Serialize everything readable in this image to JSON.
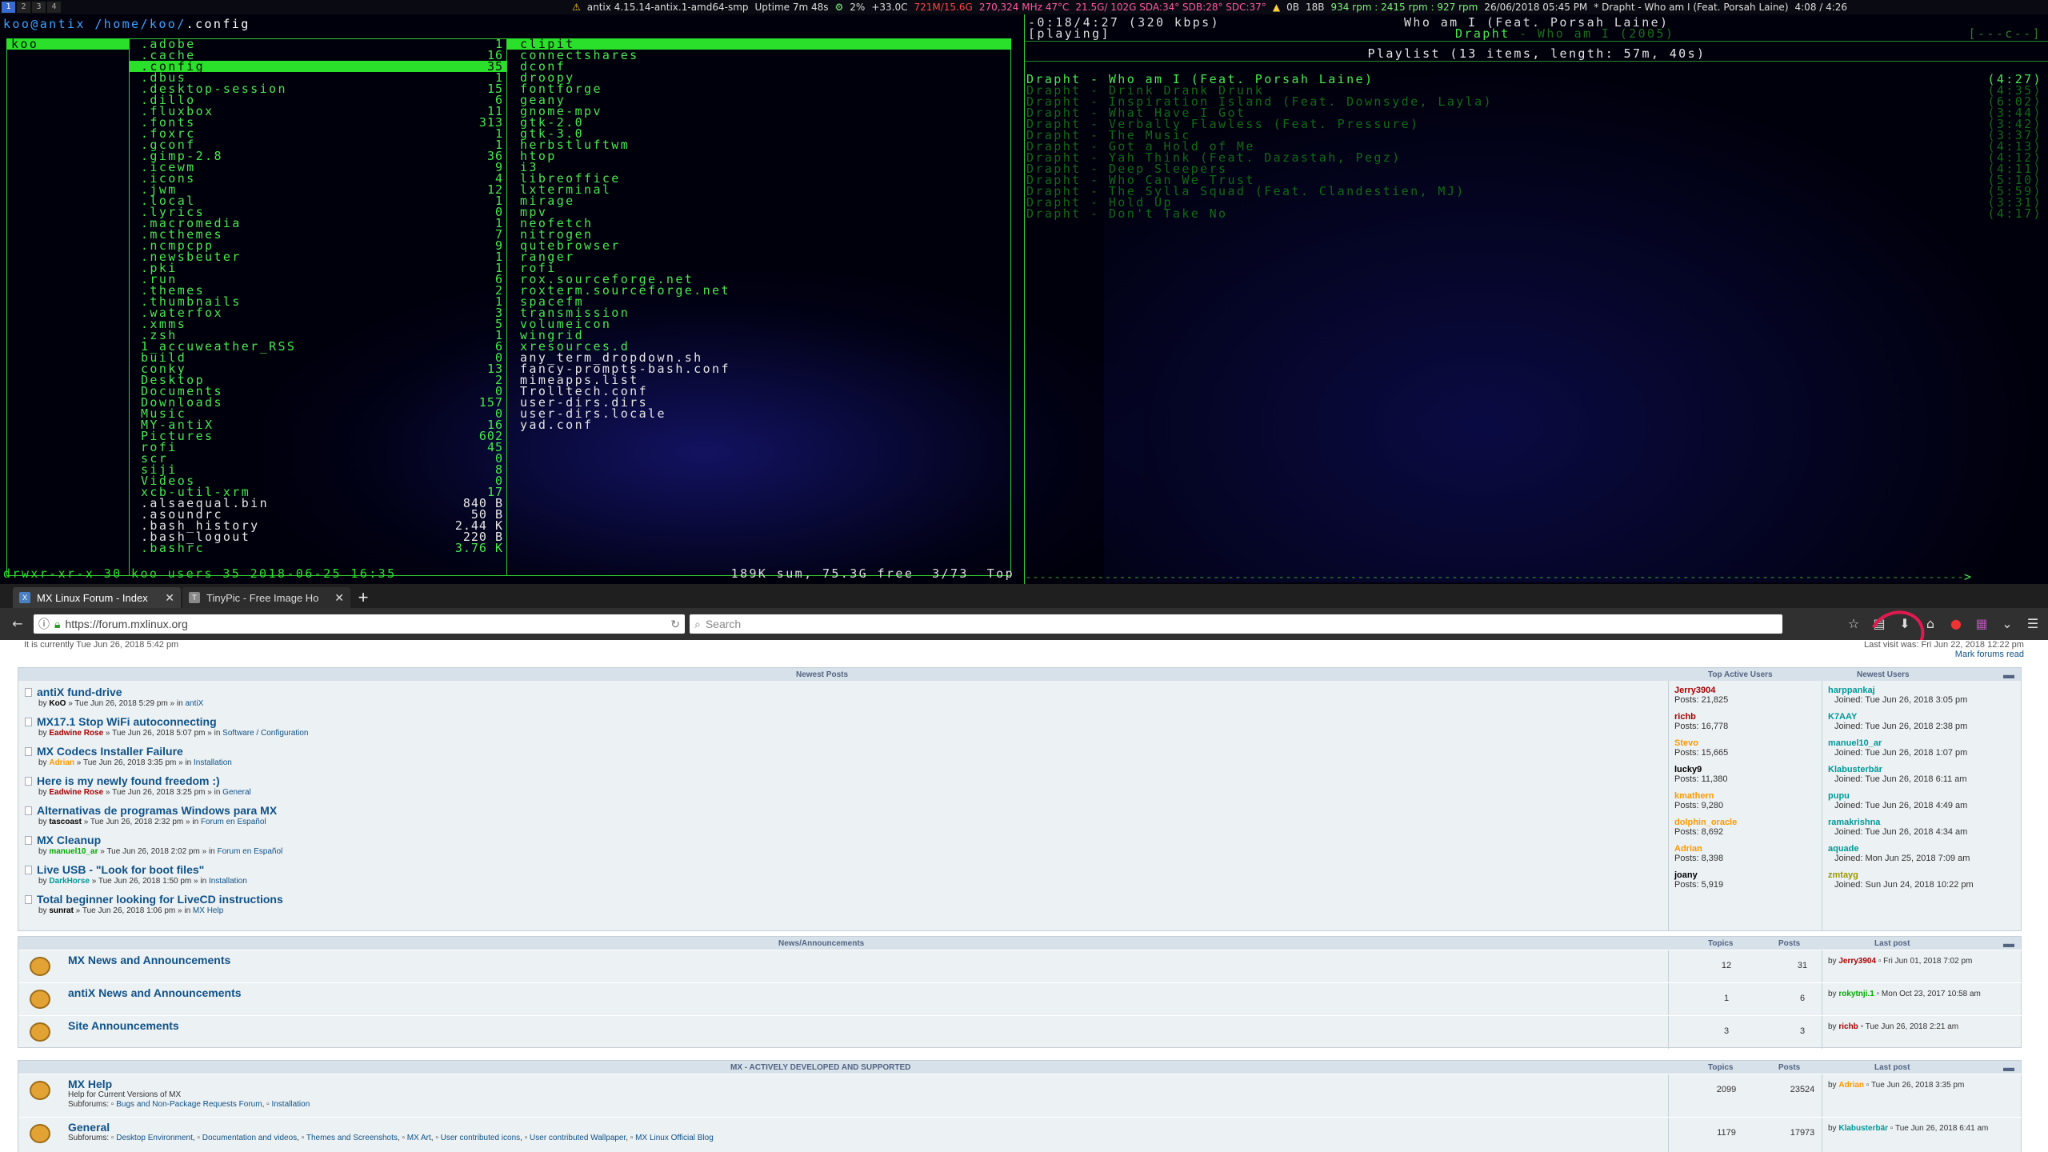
{
  "topbar": {
    "workspaces": [
      "1",
      "2",
      "3",
      "4"
    ],
    "system": "antix 4.15.14-antix.1-amd64-smp",
    "uptime": "Uptime 7m 48s",
    "cpu": "2%",
    "temp": "+33.0C",
    "mem": "721M/15.6G",
    "freq": "270,324 MHz 47°C",
    "disk": "21.5G/ 102G SDA:34° SDB:28° SDC:37°",
    "net": "0B",
    "net2": "18B",
    "fan": "934 rpm : 2415 rpm : 927 rpm",
    "date": "26/06/2018 05:45 PM",
    "nowplaying": "* Drapht - Who am I (Feat. Porsah Laine)",
    "time": "4:08 / 4:26"
  },
  "ranger": {
    "user": "koo@antix",
    "path": "/home/koo/",
    "current": ".config",
    "parent": [
      {
        "name": "koo",
        "selected": true
      }
    ],
    "middle": [
      {
        "name": ".adobe",
        "size": "1"
      },
      {
        "name": ".cache",
        "size": "16"
      },
      {
        "name": ".config",
        "size": "35",
        "selected": true
      },
      {
        "name": ".dbus",
        "size": "1"
      },
      {
        "name": ".desktop-session",
        "size": "15"
      },
      {
        "name": ".dillo",
        "size": "6"
      },
      {
        "name": ".fluxbox",
        "size": "11"
      },
      {
        "name": ".fonts",
        "size": "313"
      },
      {
        "name": ".foxrc",
        "size": "1"
      },
      {
        "name": ".gconf",
        "size": "1"
      },
      {
        "name": ".gimp-2.8",
        "size": "36"
      },
      {
        "name": ".icewm",
        "size": "9"
      },
      {
        "name": ".icons",
        "size": "4"
      },
      {
        "name": ".jwm",
        "size": "12"
      },
      {
        "name": ".local",
        "size": "1"
      },
      {
        "name": ".lyrics",
        "size": "0"
      },
      {
        "name": ".macromedia",
        "size": "1"
      },
      {
        "name": ".mcthemes",
        "size": "7"
      },
      {
        "name": ".ncmpcpp",
        "size": "9"
      },
      {
        "name": ".newsbeuter",
        "size": "1"
      },
      {
        "name": ".pki",
        "size": "1"
      },
      {
        "name": ".run",
        "size": "6"
      },
      {
        "name": ".themes",
        "size": "2"
      },
      {
        "name": ".thumbnails",
        "size": "1"
      },
      {
        "name": ".waterfox",
        "size": "3"
      },
      {
        "name": ".xmms",
        "size": "5"
      },
      {
        "name": ".zsh",
        "size": "1"
      },
      {
        "name": "1_accuweather_RSS",
        "size": "6"
      },
      {
        "name": "build",
        "size": "0"
      },
      {
        "name": "conky",
        "size": "13"
      },
      {
        "name": "Desktop",
        "size": "2"
      },
      {
        "name": "Documents",
        "size": "0"
      },
      {
        "name": "Downloads",
        "size": "157"
      },
      {
        "name": "Music",
        "size": "0"
      },
      {
        "name": "MY-antiX",
        "size": "16"
      },
      {
        "name": "Pictures",
        "size": "602"
      },
      {
        "name": "rofi",
        "size": "45"
      },
      {
        "name": "scr",
        "size": "0"
      },
      {
        "name": "siji",
        "size": "8"
      },
      {
        "name": "Videos",
        "size": "0"
      },
      {
        "name": "xcb-util-xrm",
        "size": "17"
      },
      {
        "name": ".alsaequal.bin",
        "size": "840 B",
        "file": true
      },
      {
        "name": ".asoundrc",
        "size": "50 B",
        "file": true
      },
      {
        "name": ".bash_history",
        "size": "2.44 K",
        "file": true
      },
      {
        "name": ".bash_logout",
        "size": "220 B",
        "file": true
      },
      {
        "name": ".bashrc",
        "size": "3.76 K"
      }
    ],
    "right": [
      {
        "name": "clipit",
        "selected": true
      },
      {
        "name": "connectshares"
      },
      {
        "name": "dconf"
      },
      {
        "name": "droopy"
      },
      {
        "name": "fontforge"
      },
      {
        "name": "geany"
      },
      {
        "name": "gnome-mpv"
      },
      {
        "name": "gtk-2.0"
      },
      {
        "name": "gtk-3.0"
      },
      {
        "name": "herbstluftwm"
      },
      {
        "name": "htop"
      },
      {
        "name": "i3"
      },
      {
        "name": "libreoffice"
      },
      {
        "name": "lxterminal"
      },
      {
        "name": "mirage"
      },
      {
        "name": "mpv"
      },
      {
        "name": "neofetch"
      },
      {
        "name": "nitrogen"
      },
      {
        "name": "qutebrowser"
      },
      {
        "name": "ranger"
      },
      {
        "name": "rofi"
      },
      {
        "name": "rox.sourceforge.net"
      },
      {
        "name": "roxterm.sourceforge.net"
      },
      {
        "name": "spacefm"
      },
      {
        "name": "transmission"
      },
      {
        "name": "volumeicon"
      },
      {
        "name": "wingrid"
      },
      {
        "name": "xresources.d"
      },
      {
        "name": "any_term_dropdown.sh",
        "file": true
      },
      {
        "name": "fancy-prompts-bash.conf",
        "file": true
      },
      {
        "name": "mimeapps.list",
        "file": true
      },
      {
        "name": "Trolltech.conf",
        "file": true
      },
      {
        "name": "user-dirs.dirs",
        "file": true
      },
      {
        "name": "user-dirs.locale",
        "file": true
      },
      {
        "name": "yad.conf",
        "file": true
      }
    ],
    "status_left": "drwxr-xr-x 30 koo users 35 2018-06-25 16:35",
    "status_right": "189K sum, 75.3G free  3/73  Top"
  },
  "player": {
    "time": "-0:18/4:27 (320 kbps)",
    "state": "[playing]",
    "title": "Who am I (Feat. Porsah Laine)",
    "artist": "Drapht",
    "album": " - Who am I (2005)",
    "corner": "[---c--]",
    "playlist_header": "Playlist (13 items, length: 57m, 40s)",
    "playlist": [
      {
        "track": "Drapht - Who am I (Feat. Porsah Laine)",
        "len": "(4:27)",
        "current": true
      },
      {
        "track": "Drapht - Drink Drank Drunk",
        "len": "(4:35)"
      },
      {
        "track": "Drapht - Inspiration Island (Feat. Downsyde, Layla)",
        "len": "(6:02)"
      },
      {
        "track": "Drapht - What Have I Got",
        "len": "(3:44)"
      },
      {
        "track": "Drapht - Verbally Flawless (Feat. Pressure)",
        "len": "(3:42)"
      },
      {
        "track": "Drapht - The Music",
        "len": "(3:37)"
      },
      {
        "track": "Drapht - Got a Hold of Me",
        "len": "(4:13)"
      },
      {
        "track": "Drapht - Yah Think (Feat. Dazastah, Pegz)",
        "len": "(4:12)"
      },
      {
        "track": "Drapht - Deep Sleepers",
        "len": "(4:11)"
      },
      {
        "track": "Drapht - Who Can We Trust",
        "len": "(5:10)"
      },
      {
        "track": "Drapht - The Sylla Squad (Feat. Clandestien, MJ)",
        "len": "(5:59)"
      },
      {
        "track": "Drapht - Hold Up",
        "len": "(3:31)"
      },
      {
        "track": "Drapht - Don't Take No",
        "len": "(4:17)"
      }
    ],
    "progress": 0.93
  },
  "browser": {
    "tabs": [
      {
        "label": "MX Linux Forum - Index",
        "fav": "X",
        "active": true
      },
      {
        "label": "TinyPic - Free Image Ho",
        "fav": "T",
        "active": false
      }
    ],
    "url": "https://forum.mxlinux.org",
    "search_placeholder": "Search"
  },
  "forum": {
    "last_visit": "It is currently Tue Jun 26, 2018 5:42 pm",
    "last_right": "Last visit was: Fri Jun 22, 2018 12:22 pm",
    "mark_read": "Mark forums read",
    "newest_posts_header": "Newest Posts",
    "top_active_header": "Top Active Users",
    "newest_users_header": "Newest Users",
    "posts": [
      {
        "title": "antiX fund-drive",
        "author": "KoO",
        "author_color": "#000000",
        "date": "Tue Jun 26, 2018 5:29 pm",
        "forum": "antiX"
      },
      {
        "title": "MX17.1 Stop WiFi autoconnecting",
        "author": "Eadwine Rose",
        "author_color": "#aa0000",
        "date": "Tue Jun 26, 2018 5:07 pm",
        "forum": "Software / Configuration"
      },
      {
        "title": "MX Codecs Installer Failure",
        "author": "Adrian",
        "author_color": "#ff9900",
        "date": "Tue Jun 26, 2018 3:35 pm",
        "forum": "Installation"
      },
      {
        "title": "Here is my newly found freedom :)",
        "author": "Eadwine Rose",
        "author_color": "#aa0000",
        "date": "Tue Jun 26, 2018 3:25 pm",
        "forum": "General"
      },
      {
        "title": "Alternativas de programas Windows para MX",
        "author": "tascoast",
        "author_color": "#000000",
        "date": "Tue Jun 26, 2018 2:32 pm",
        "forum": "Forum en Español"
      },
      {
        "title": "MX Cleanup",
        "author": "manuel10_ar",
        "author_color": "#00aa00",
        "date": "Tue Jun 26, 2018 2:02 pm",
        "forum": "Forum en Español"
      },
      {
        "title": "Live USB - \"Look for boot files\"",
        "author": "DarkHorse",
        "author_color": "#009999",
        "date": "Tue Jun 26, 2018 1:50 pm",
        "forum": "Installation"
      },
      {
        "title": "Total beginner looking for LiveCD instructions",
        "author": "sunrat",
        "author_color": "#000000",
        "date": "Tue Jun 26, 2018 1:06 pm",
        "forum": "MX Help"
      }
    ],
    "top_users": [
      {
        "name": "Jerry3904",
        "color": "#aa0000",
        "posts": "Posts: 21,825"
      },
      {
        "name": "richb",
        "color": "#aa0000",
        "posts": "Posts: 16,778"
      },
      {
        "name": "Stevo",
        "color": "#ff9900",
        "posts": "Posts: 15,665"
      },
      {
        "name": "lucky9",
        "color": "#000000",
        "posts": "Posts: 11,380"
      },
      {
        "name": "kmathern",
        "color": "#ff9900",
        "posts": "Posts: 9,280"
      },
      {
        "name": "dolphin_oracle",
        "color": "#ff9900",
        "posts": "Posts: 8,692"
      },
      {
        "name": "Adrian",
        "color": "#ff9900",
        "posts": "Posts: 8,398"
      },
      {
        "name": "joany",
        "color": "#000000",
        "posts": "Posts: 5,919"
      }
    ],
    "newest_users": [
      {
        "name": "harppankaj",
        "color": "#009999",
        "joined": "Joined: Tue Jun 26, 2018 3:05 pm"
      },
      {
        "name": "K7AAY",
        "color": "#009999",
        "joined": "Joined: Tue Jun 26, 2018 2:38 pm"
      },
      {
        "name": "manuel10_ar",
        "color": "#009999",
        "joined": "Joined: Tue Jun 26, 2018 1:07 pm"
      },
      {
        "name": "Klabusterbär",
        "color": "#009999",
        "joined": "Joined: Tue Jun 26, 2018 6:11 am"
      },
      {
        "name": "pupu",
        "color": "#009999",
        "joined": "Joined: Tue Jun 26, 2018 4:49 am"
      },
      {
        "name": "ramakrishna",
        "color": "#009999",
        "joined": "Joined: Tue Jun 26, 2018 4:34 am"
      },
      {
        "name": "aquade",
        "color": "#009999",
        "joined": "Joined: Mon Jun 25, 2018 7:09 am"
      },
      {
        "name": "zmtayg",
        "color": "#999900",
        "joined": "Joined: Sun Jun 24, 2018 10:22 pm"
      }
    ],
    "news_header": "News/Announcements",
    "col_topics": "Topics",
    "col_posts": "Posts",
    "col_last": "Last post",
    "news": [
      {
        "name": "MX News and Announcements",
        "topics": "12",
        "posts": "31",
        "by": "Jerry3904",
        "by_color": "#aa0000",
        "date": "Fri Jun 01, 2018 7:02 pm"
      },
      {
        "name": "antiX News and Announcements",
        "topics": "1",
        "posts": "6",
        "by": "rokytnji.1",
        "by_color": "#00aa00",
        "date": "Mon Oct 23, 2017 10:58 am"
      },
      {
        "name": "Site Announcements",
        "topics": "3",
        "posts": "3",
        "by": "richb",
        "by_color": "#aa0000",
        "date": "Tue Jun 26, 2018 2:21 am"
      }
    ],
    "mx_header": "MX - ACTIVELY DEVELOPED AND SUPPORTED",
    "mx": [
      {
        "name": "MX Help",
        "desc": "Help for Current Versions of MX",
        "subforums": [
          "Bugs and Non-Package Requests Forum",
          "Installation"
        ],
        "topics": "2099",
        "posts": "23524",
        "by": "Adrian",
        "by_color": "#ff9900",
        "date": "Tue Jun 26, 2018 3:35 pm"
      },
      {
        "name": "General",
        "desc": "",
        "subforums": [
          "Desktop Environment",
          "Documentation and videos",
          "Themes and Screenshots",
          "MX Art",
          "User contributed icons",
          "User contributed Wallpaper",
          "MX Linux Official Blog"
        ],
        "topics": "1179",
        "posts": "17973",
        "by": "Klabusterbär",
        "by_color": "#009999",
        "date": "Tue Jun 26, 2018 6:41 am"
      }
    ]
  },
  "colors": {
    "term_green": "#47e84d",
    "accent_blue": "#105289"
  }
}
